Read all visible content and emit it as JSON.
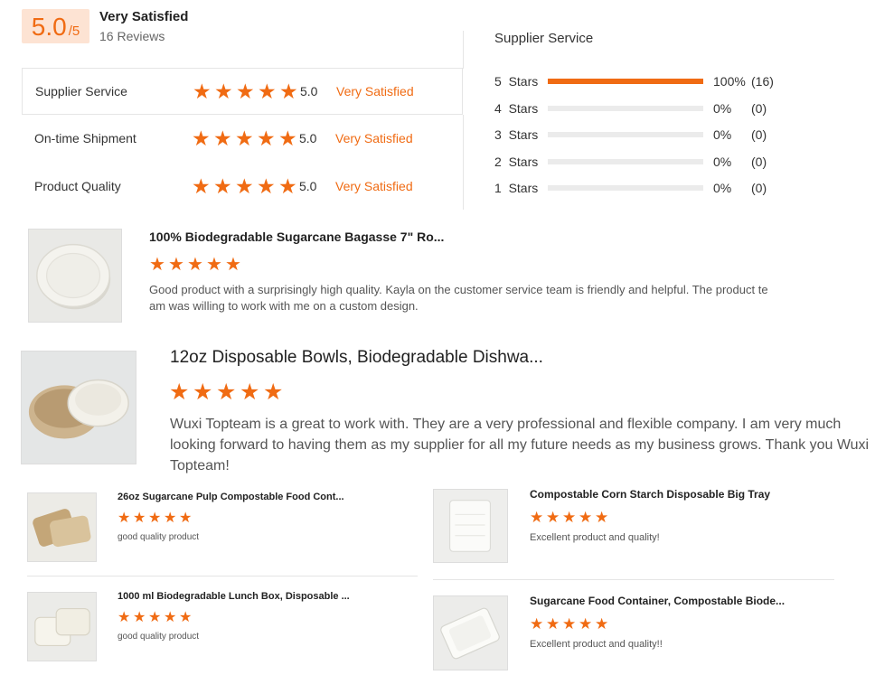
{
  "overall": {
    "score": "5.0",
    "scale": "/5",
    "label": "Very Satisfied",
    "reviews": "16 Reviews"
  },
  "categories": [
    {
      "name": "Supplier Service",
      "score": "5.0",
      "desc": "Very Satisfied",
      "stars": 5
    },
    {
      "name": "On-time Shipment",
      "score": "5.0",
      "desc": "Very Satisfied",
      "stars": 5
    },
    {
      "name": "Product Quality",
      "score": "5.0",
      "desc": "Very Satisfied",
      "stars": 5
    }
  ],
  "histogram": {
    "title": "Supplier Service",
    "rows": [
      {
        "label": "5  Stars",
        "fraction": 1.0,
        "pct": "100%",
        "count": "(16)"
      },
      {
        "label": "4  Stars",
        "fraction": 0,
        "pct": "0%",
        "count": "(0)"
      },
      {
        "label": "3  Stars",
        "fraction": 0,
        "pct": "0%",
        "count": "(0)"
      },
      {
        "label": "2  Stars",
        "fraction": 0,
        "pct": "0%",
        "count": "(0)"
      },
      {
        "label": "1  Stars",
        "fraction": 0,
        "pct": "0%",
        "count": "(0)"
      }
    ]
  },
  "reviews": [
    {
      "title": "100% Biodegradable Sugarcane Bagasse 7\" Ro...",
      "text": "Good product with a surprisingly high quality. Kayla on the customer service team is friendly and helpful. The product team was willing to work with me on a custom design.",
      "stars": 5,
      "image": "round-plate-image"
    },
    {
      "title": "12oz Disposable Bowls, Biodegradable Dishwa...",
      "text": "Wuxi Topteam is a great to work with. They are a very professional and flexible company. I am very much looking forward to having them as my supplier for all my future needs as my business grows. Thank you Wuxi Topteam!",
      "stars": 5,
      "image": "bowls-image"
    },
    {
      "title": "26oz Sugarcane Pulp Compostable Food Cont...",
      "text": "good quality product",
      "stars": 5,
      "image": "pulp-containers-image"
    },
    {
      "title": "Compostable Corn Starch Disposable Big Tray",
      "text": "Excellent product and quality!",
      "stars": 5,
      "image": "big-tray-image"
    },
    {
      "title": "1000 ml Biodegradable Lunch Box, Disposable ...",
      "text": "good quality product",
      "stars": 5,
      "image": "lunch-box-image"
    },
    {
      "title": "Sugarcane Food Container, Compostable Biode...",
      "text": "Excellent product and quality!!",
      "stars": 5,
      "image": "food-container-image"
    }
  ],
  "colors": {
    "accent": "#f06b13",
    "accent_bg": "#fde3d3",
    "track": "#ebebeb"
  }
}
